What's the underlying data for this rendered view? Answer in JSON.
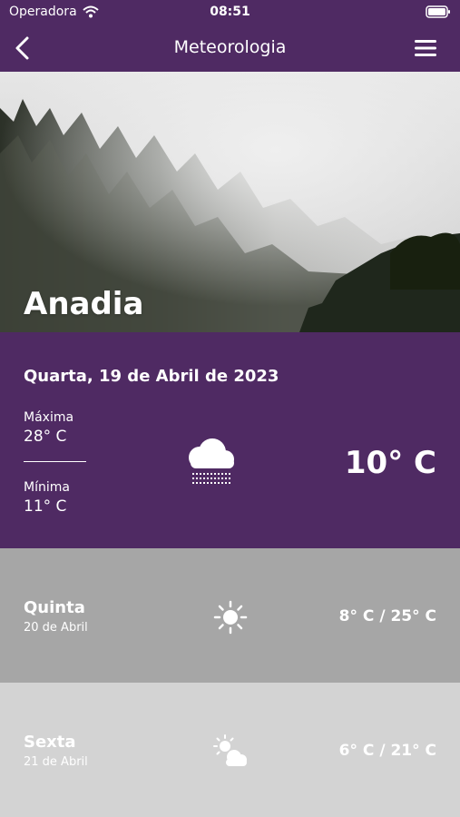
{
  "status_bar": {
    "carrier": "Operadora",
    "time": "08:51"
  },
  "nav": {
    "title": "Meteorologia",
    "back_icon": "chevron-left-icon",
    "menu_icon": "hamburger-menu-icon"
  },
  "hero": {
    "city": "Anadia"
  },
  "today": {
    "date": "Quarta, 19 de Abril de 2023",
    "max_label": "Máxima",
    "max_value": "28° C",
    "min_label": "Mínima",
    "min_value": "11° C",
    "icon": "fog-cloud-icon",
    "current": "10° C"
  },
  "forecast": [
    {
      "day": "Quinta",
      "date": "20 de Abril",
      "icon": "sun-icon",
      "range": "8° C / 25° C"
    },
    {
      "day": "Sexta",
      "date": "21 de Abril",
      "icon": "partly-cloudy-icon",
      "range": "6° C / 21° C"
    }
  ],
  "colors": {
    "primary": "#4f2a63",
    "row_dark": "#a6a6a6",
    "row_light": "#d3d3d3"
  }
}
